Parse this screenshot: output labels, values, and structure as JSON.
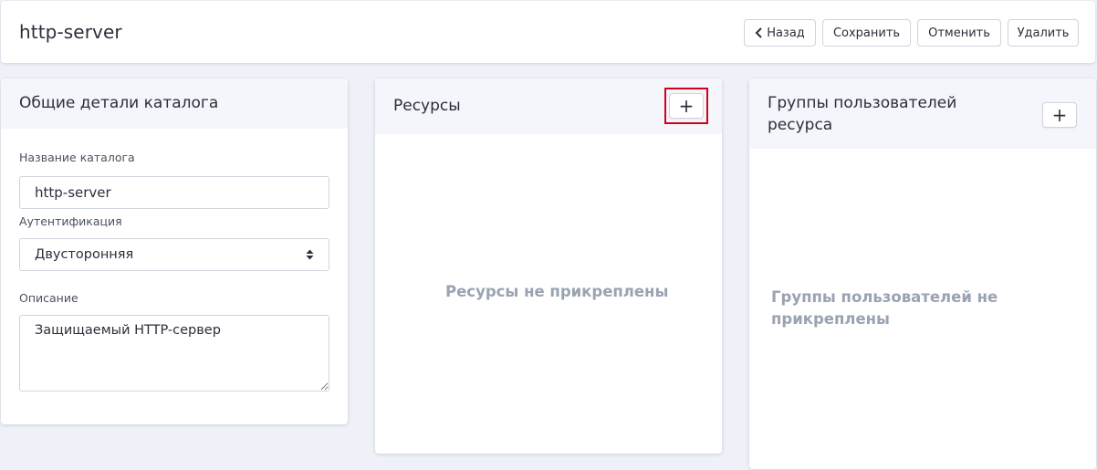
{
  "header": {
    "title": "http-server",
    "buttons": {
      "back_label": "Назад",
      "save_label": "Сохранить",
      "cancel_label": "Отменить",
      "delete_label": "Удалить"
    }
  },
  "details": {
    "title": "Общие детали каталога",
    "name_label": "Название каталога",
    "name_value": "http-server",
    "auth_label": "Аутентификация",
    "auth_value": "Двусторонняя",
    "description_label": "Описание",
    "description_value": "Защищаемый HTTP-сервер"
  },
  "resources": {
    "title": "Ресурсы",
    "add_label": "+",
    "empty_text": "Ресурсы не прикреплены"
  },
  "groups": {
    "title": "Группы пользователей ресурса",
    "add_label": "+",
    "empty_text": "Группы пользователей не прикреплены"
  },
  "icons": {
    "back": "chevron-left-icon",
    "select": "select-arrows-icon",
    "add": "plus-icon"
  },
  "colors": {
    "page_background": "#eef1f8",
    "card_header": "#f4f6fb",
    "empty_text": "#9aa3b2",
    "highlight": "#d0021b"
  }
}
